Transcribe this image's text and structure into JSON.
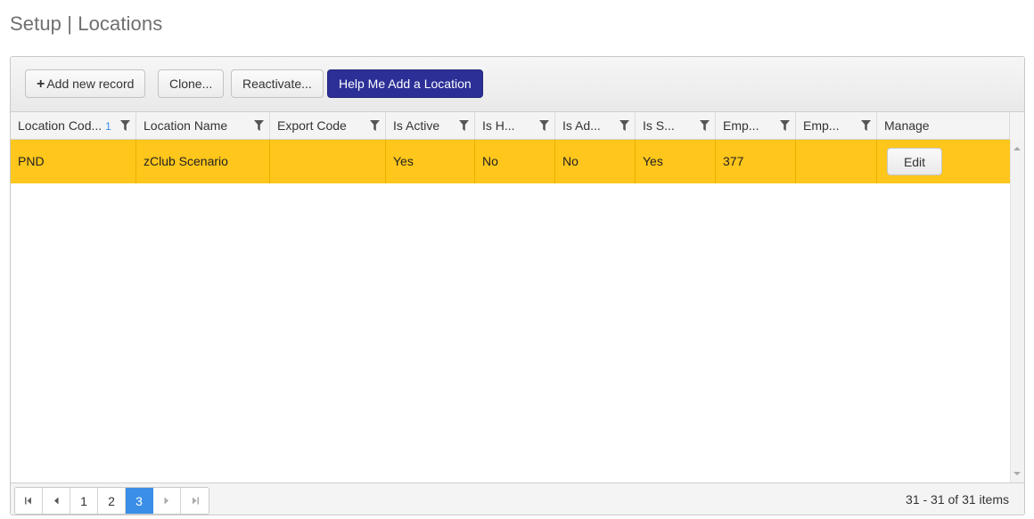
{
  "page": {
    "title": "Setup | Locations"
  },
  "toolbar": {
    "add_label": "Add new record",
    "clone_label": "Clone...",
    "reactivate_label": "Reactivate...",
    "help_label": "Help Me Add a Location",
    "help_color": "#2b2f96"
  },
  "columns": [
    {
      "label": "Location Cod...",
      "sort_index": "1",
      "filter_icon": "filter-icon"
    },
    {
      "label": "Location Name",
      "filter_icon": "filter-icon"
    },
    {
      "label": "Export Code",
      "filter_icon": "filter-icon"
    },
    {
      "label": "Is Active",
      "filter_icon": "filter-icon"
    },
    {
      "label": "Is H...",
      "filter_icon": "filter-icon"
    },
    {
      "label": "Is Ad...",
      "filter_icon": "filter-icon"
    },
    {
      "label": "Is S...",
      "filter_icon": "filter-icon"
    },
    {
      "label": "Emp...",
      "filter_icon": "filter-icon"
    },
    {
      "label": "Emp...",
      "filter_icon": "filter-icon"
    },
    {
      "label": "Manage"
    }
  ],
  "rows": [
    {
      "cells": [
        "PND",
        "zClub Scenario",
        "",
        "Yes",
        "No",
        "No",
        "Yes",
        "377",
        ""
      ],
      "manage_label": "Edit",
      "highlight_color": "#ffc61b"
    }
  ],
  "pager": {
    "pages": [
      "1",
      "2",
      "3"
    ],
    "current_page": "3",
    "info": "31 - 31 of 31 items",
    "active_color": "#3a8ee6"
  }
}
